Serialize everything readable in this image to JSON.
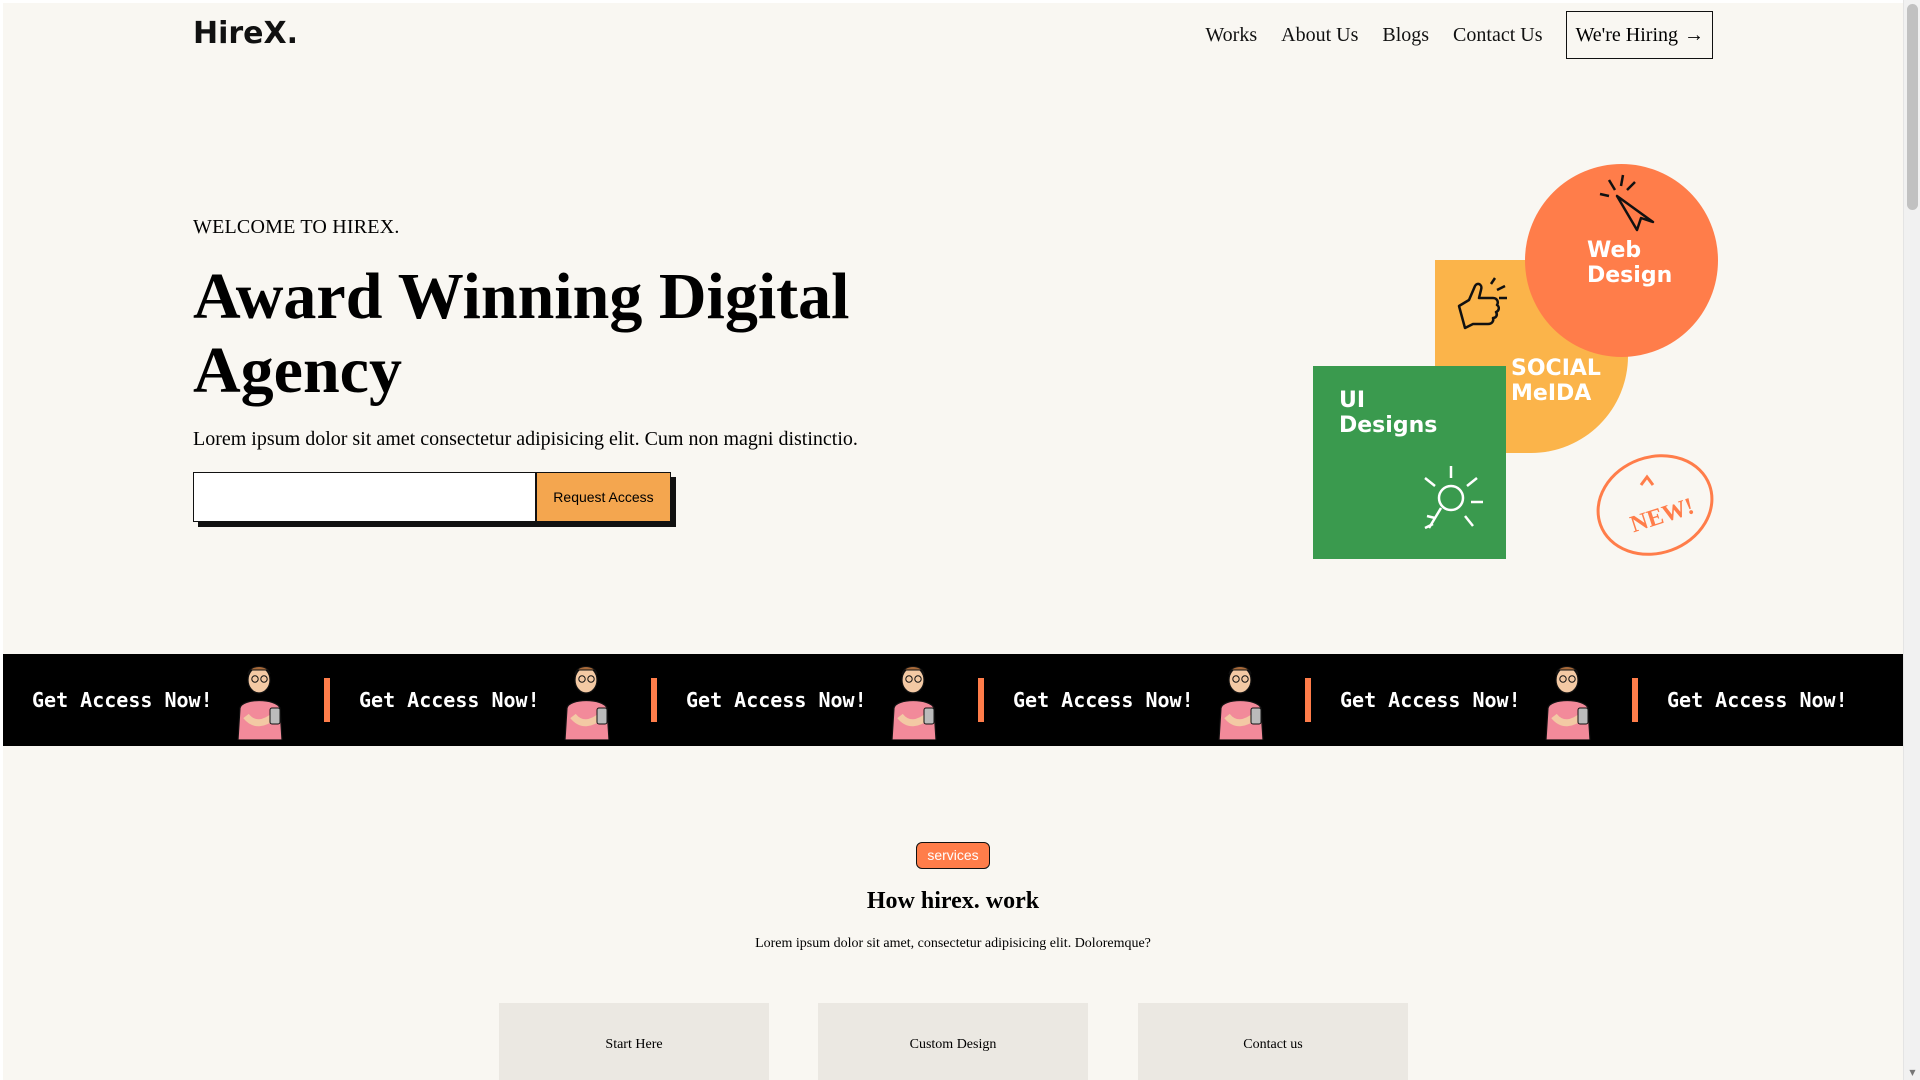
{
  "header": {
    "logo_text": "HireX.",
    "nav": [
      "Works",
      "About Us",
      "Blogs",
      "Contact Us"
    ],
    "hiring_label": "We're Hiring",
    "hiring_arrow": "→"
  },
  "hero": {
    "eyebrow": "WELCOME TO HIREX.",
    "title": "Award Winning Digital Agency",
    "subtitle": "Lorem ipsum dolor sit amet consectetur adipisicing elit. Cum non magni distinctio.",
    "email_value": "",
    "request_label": "Request Access"
  },
  "illustration": {
    "ui_label": "UI\nDesigns",
    "social_label": "SOCIAL\nMeIDA",
    "web_label": "Web\nDesign",
    "new_label": "NEW!",
    "colors": {
      "green": "#3a9a4e",
      "yellow": "#fbb44a",
      "orange": "#ff7d4a"
    }
  },
  "ticker": {
    "items": [
      "Get Access Now!",
      "Get Access Now!",
      "Get Access Now!",
      "Get Access Now!",
      "Get Access Now!",
      "Get Access Now!"
    ]
  },
  "services": {
    "badge": "services",
    "title": "How hirex. work",
    "subtitle": "Lorem ipsum dolor sit amet, consectetur adipisicing elit. Doloremque?",
    "cards": [
      "Start Here",
      "Custom Design",
      "Contact us"
    ]
  },
  "accent_color": "#ff7d4a"
}
